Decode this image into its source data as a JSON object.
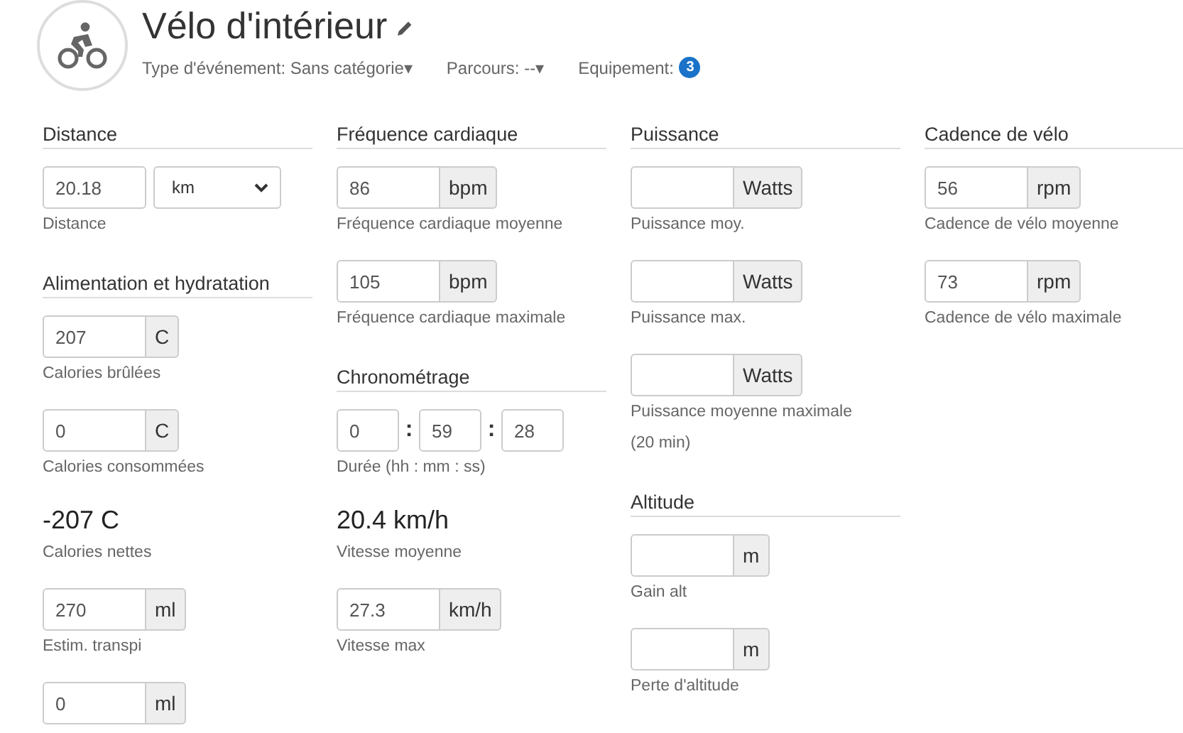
{
  "header": {
    "title": "Vélo d'intérieur",
    "meta": [
      {
        "kind": "dropdown",
        "label": "Type d'événement: Sans catégorie",
        "caret": "▾"
      },
      {
        "kind": "dropdown",
        "label": "Parcours: --",
        "caret": "▾"
      },
      {
        "kind": "badge",
        "label": "Equipement:",
        "count": "3"
      }
    ]
  },
  "columns": [
    {
      "sections": [
        {
          "title": "Distance",
          "items": [
            {
              "kind": "select",
              "value": "20.18",
              "unit": "km",
              "caption": "Distance"
            }
          ]
        },
        {
          "title": "Alimentation et hydratation",
          "items": [
            {
              "kind": "input",
              "value": "207",
              "unit": "C",
              "caption": "Calories brûlées"
            },
            {
              "kind": "input",
              "value": "0",
              "unit": "C",
              "caption": "Calories consommées"
            },
            {
              "kind": "readout",
              "value": "-207 C",
              "caption": "Calories nettes"
            },
            {
              "kind": "input",
              "value": "270",
              "unit": "ml",
              "caption": "Estim. transpi"
            },
            {
              "kind": "input",
              "value": "0",
              "unit": "ml"
            }
          ]
        }
      ]
    },
    {
      "sections": [
        {
          "title": "Fréquence cardiaque",
          "items": [
            {
              "kind": "input",
              "value": "86",
              "unit": "bpm",
              "caption": "Fréquence cardiaque moyenne"
            },
            {
              "kind": "input",
              "value": "105",
              "unit": "bpm",
              "caption": "Fréquence cardiaque maximale"
            }
          ]
        },
        {
          "title": "Chronométrage",
          "items": [
            {
              "kind": "time",
              "parts": [
                "0",
                "59",
                "28"
              ],
              "separator": ":",
              "caption": "Durée (hh : mm : ss)"
            },
            {
              "kind": "readout",
              "value": "20.4 km/h",
              "caption": "Vitesse moyenne"
            },
            {
              "kind": "input",
              "value": "27.3",
              "unit": "km/h",
              "caption": "Vitesse max"
            }
          ]
        }
      ]
    },
    {
      "sections": [
        {
          "title": "Puissance",
          "items": [
            {
              "kind": "input",
              "unit": "Watts",
              "caption": "Puissance moy."
            },
            {
              "kind": "input",
              "unit": "Watts",
              "caption": "Puissance max."
            },
            {
              "kind": "input",
              "unit": "Watts",
              "caption": "Puissance moyenne maximale (20 min)"
            }
          ]
        },
        {
          "title": "Altitude",
          "items": [
            {
              "kind": "input",
              "unit": "m",
              "caption": "Gain alt"
            },
            {
              "kind": "input",
              "unit": "m",
              "caption": "Perte d'altitude"
            }
          ]
        }
      ]
    },
    {
      "sections": [
        {
          "title": "Cadence de vélo",
          "items": [
            {
              "kind": "input",
              "value": "56",
              "unit": "rpm",
              "caption": "Cadence de vélo moyenne"
            },
            {
              "kind": "input",
              "value": "73",
              "unit": "rpm",
              "caption": "Cadence de vélo maximale"
            }
          ]
        }
      ]
    }
  ]
}
